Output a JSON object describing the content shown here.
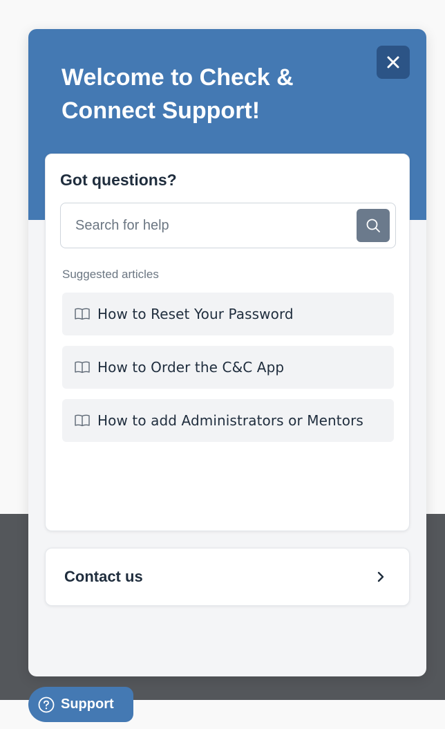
{
  "widget": {
    "title": "Welcome to Check & Connect Support!",
    "close_icon": "close-icon"
  },
  "help": {
    "heading": "Got questions?",
    "search": {
      "placeholder": "Search for help",
      "value": "",
      "icon": "search-icon"
    },
    "suggested_label": "Suggested articles",
    "articles": [
      {
        "label": "How to Reset Your Password",
        "icon": "book-icon"
      },
      {
        "label": "How to Order the C&C App",
        "icon": "book-icon"
      },
      {
        "label": "How to add Administrators or Mentors",
        "icon": "book-icon"
      }
    ]
  },
  "contact": {
    "label": "Contact us",
    "icon": "chevron-right-icon"
  },
  "launcher": {
    "label": "Support",
    "icon": "help-circle-icon"
  },
  "colors": {
    "header_bg": "#4479b3",
    "close_bg": "#2c5486",
    "search_button_bg": "#6b7a8c",
    "page_dark_band": "#54575b",
    "text_dark": "#1f2d3d"
  }
}
